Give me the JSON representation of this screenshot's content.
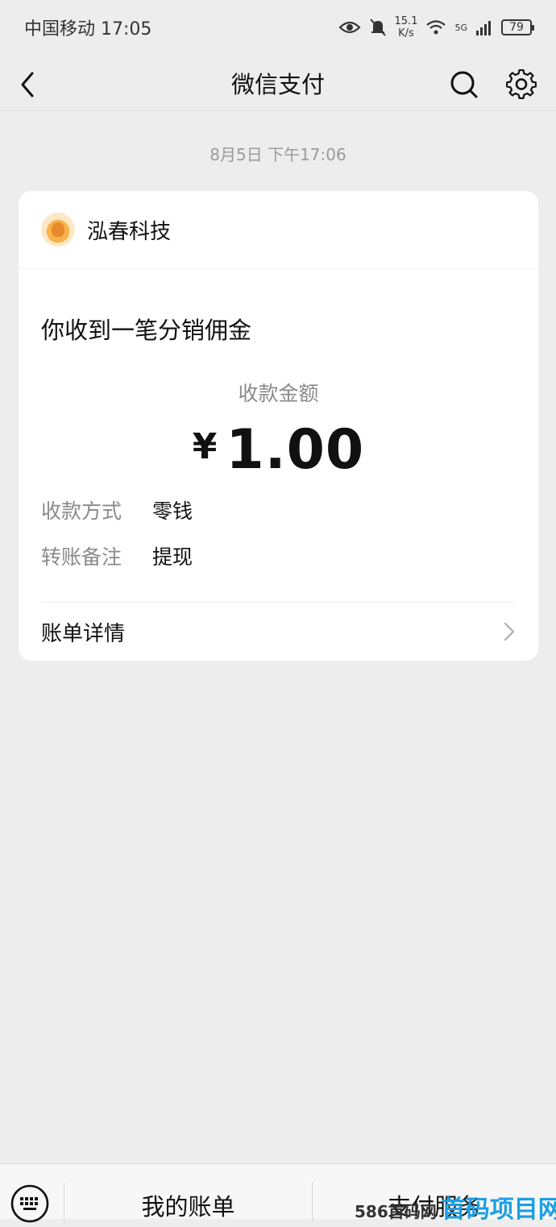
{
  "status_bar": {
    "carrier_time": "中国移动 17:05",
    "net_speed_value": "15.1",
    "net_speed_unit": "K/s",
    "signal_label": "5G",
    "battery": "79",
    "icons": [
      "eye-icon",
      "bell-off-icon",
      "wifi-icon",
      "signal-icon",
      "battery-icon"
    ]
  },
  "nav": {
    "title": "微信支付",
    "icons": [
      "back-icon",
      "search-icon",
      "gear-icon"
    ]
  },
  "message": {
    "timestamp": "8月5日 下午17:06",
    "merchant_name": "泓春科技",
    "title": "你收到一笔分销佣金",
    "amount_label": "收款金额",
    "currency": "¥",
    "amount": "1.00",
    "rows": [
      {
        "key": "收款方式",
        "value": "零钱"
      },
      {
        "key": "转账备注",
        "value": "提现"
      }
    ],
    "detail_link": "账单详情"
  },
  "bottom_bar": {
    "menu_bill": "我的账单",
    "menu_service": "支付服务",
    "icons": [
      "keyboard-icon"
    ]
  },
  "watermark": {
    "prefix": "586首码网",
    "brand": "首码项目网"
  },
  "colors": {
    "background": "#ededed",
    "card": "#ffffff",
    "secondary_text": "#8a8a8a",
    "watermark_brand": "#1b9fe3"
  }
}
